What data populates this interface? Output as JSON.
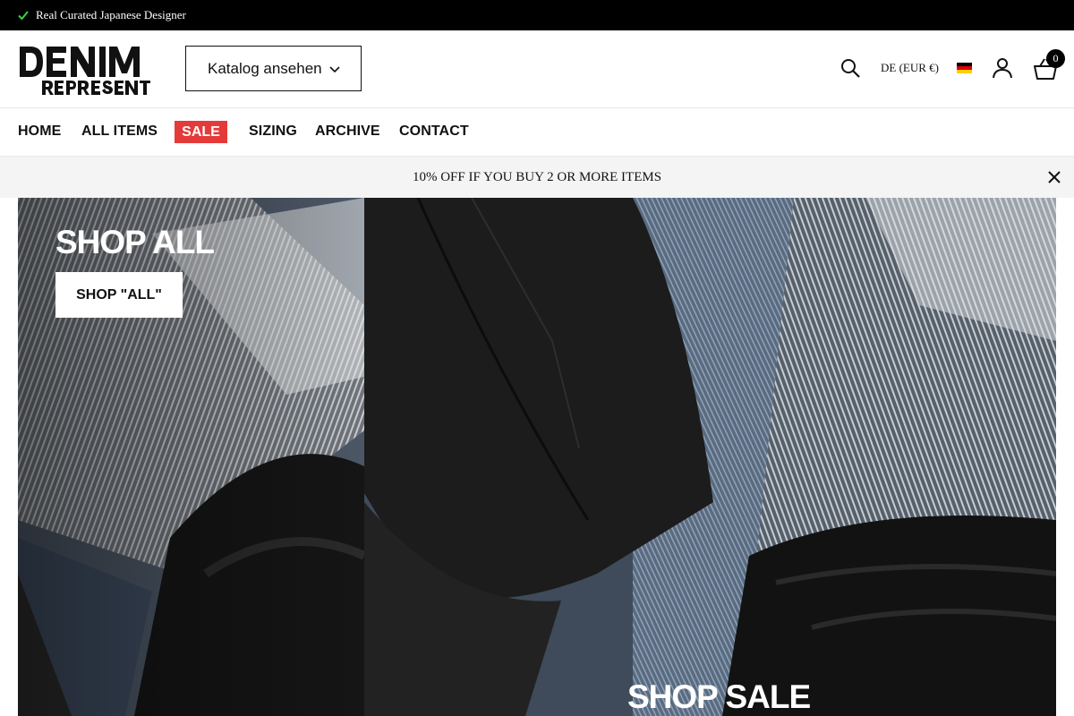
{
  "announcement": {
    "text": "Real Curated Japanese Designer",
    "icon": "check-icon"
  },
  "header": {
    "logo_text_top": "DENIM",
    "logo_text_bottom": "REPRESENT",
    "catalog_label": "Katalog ansehen",
    "locale_label": "DE (EUR €)",
    "cart_count": "0",
    "icons": [
      "search-icon",
      "flag-germany-icon",
      "user-icon",
      "cart-icon"
    ]
  },
  "nav": {
    "items": [
      "HOME",
      "ALL ITEMS",
      "SALE",
      "SIZING",
      "ARCHIVE",
      "CONTACT"
    ],
    "sale_color": "#e53a3a"
  },
  "promo": {
    "text": "10% OFF IF YOU BUY 2 OR MORE ITEMS"
  },
  "hero": {
    "left_title": "SHOP ALL",
    "left_button": "SHOP \"ALL\"",
    "right_title": "SHOP SALE"
  }
}
